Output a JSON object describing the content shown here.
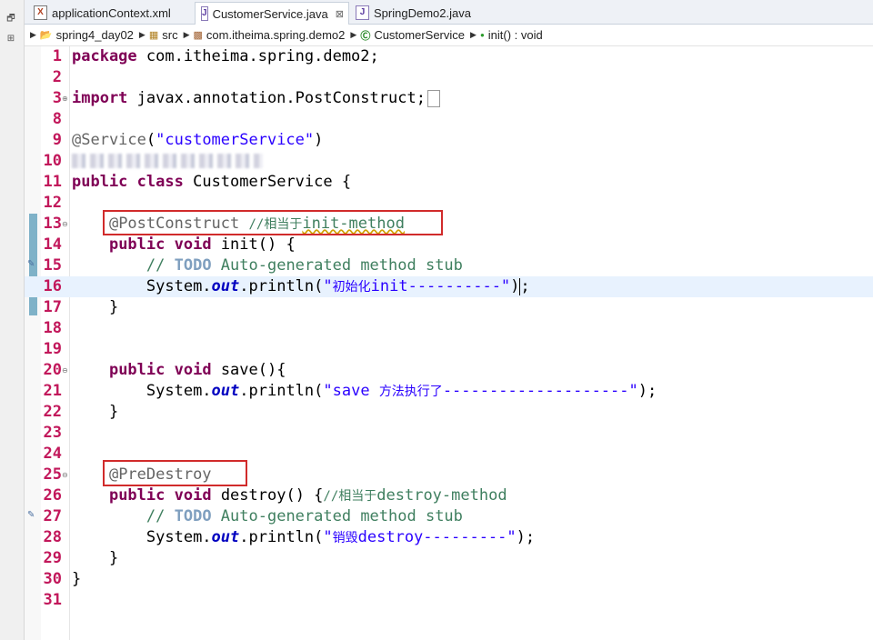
{
  "tabs": [
    {
      "label": "applicationContext.xml",
      "icon": "xml-file-icon",
      "active": false
    },
    {
      "label": "CustomerService.java",
      "icon": "java-file-icon",
      "active": true,
      "close": "⊠"
    },
    {
      "label": "SpringDemo2.java",
      "icon": "java-file-icon",
      "active": false
    }
  ],
  "breadcrumb": [
    {
      "label": "spring4_day02",
      "icon": "project-icon"
    },
    {
      "label": "src",
      "icon": "source-folder-icon"
    },
    {
      "label": "com.itheima.spring.demo2",
      "icon": "package-icon"
    },
    {
      "label": "CustomerService",
      "icon": "class-icon"
    },
    {
      "label": "init() : void",
      "icon": "method-icon"
    }
  ],
  "lines": {
    "n1": "1",
    "n2": "2",
    "n3": "3",
    "n8": "8",
    "n9": "9",
    "n10": "10",
    "n11": "11",
    "n12": "12",
    "n13": "13",
    "n14": "14",
    "n15": "15",
    "n16": "16",
    "n17": "17",
    "n18": "18",
    "n19": "19",
    "n20": "20",
    "n21": "21",
    "n22": "22",
    "n23": "23",
    "n24": "24",
    "n25": "25",
    "n26": "26",
    "n27": "27",
    "n28": "28",
    "n29": "29",
    "n30": "30",
    "n31": "31"
  },
  "code": {
    "kw_package": "package",
    "package_name": " com.itheima.spring.demo2;",
    "kw_import": "import",
    "import_name": " javax.annotation.PostConstruct;",
    "ann_service": "@Service",
    "paren_open": "(",
    "str_service": "\"customerService\"",
    "paren_close": ")",
    "kw_public": "public",
    "kw_class": "class",
    "class_decl": " CustomerService {",
    "ann_postconstruct": "@PostConstruct",
    "cmt_init_prefix": "//相当于",
    "cmt_init_suffix": "init-method",
    "kw_void": "void",
    "init_sig": " init() {",
    "cmt_slashes": "// ",
    "todo": "TODO",
    "cmt_autogen": " Auto-generated method stub",
    "system": "System.",
    "out": "out",
    "println_open": ".println(",
    "str_init_q": "\"",
    "str_init_cjk": "初始化",
    "str_init_rest": "init----------\"",
    "call_close": ")",
    "semicolon": ";",
    "close_brace": "}",
    "save_sig": " save(){",
    "str_save_a": "\"save ",
    "str_save_cjk": "方法执行了",
    "str_save_b": "--------------------\"",
    "stmt_end": ");",
    "ann_predestroy": "@PreDestroy",
    "destroy_sig": " destroy() {",
    "cmt_destroy_prefix": "//相当于",
    "cmt_destroy_suffix": "destroy-method",
    "str_destroy_q": "\"",
    "str_destroy_cjk": "销毁",
    "str_destroy_rest": "destroy---------\""
  },
  "colors": {
    "keyword": "#7f0055",
    "annotation": "#646464",
    "string": "#2a00ff",
    "comment": "#3f7f5f",
    "line_number": "#c2185b",
    "highlight_box": "#d12b2b",
    "current_line": "#e8f2fe"
  }
}
